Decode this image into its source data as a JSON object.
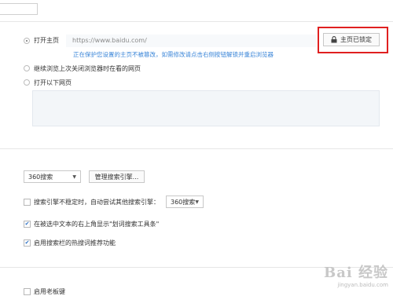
{
  "startup": {
    "options": [
      {
        "label": "打开主页",
        "selected": true
      },
      {
        "label": "继续浏览上次关闭浏览器时在看的网页",
        "selected": false
      },
      {
        "label": "打开以下网页",
        "selected": false
      }
    ],
    "homepage_url": "https://www.baidu.com/",
    "protect_hint": "正在保护您设置的主页不被篡改，如需修改请点击右侧按钮解锁并重启浏览器",
    "lock_button_label": "主页已锁定",
    "urls_textarea_value": ""
  },
  "search": {
    "engine_selected": "360搜索",
    "manage_button_label": "管理搜索引擎...",
    "fallback_label": "搜索引擎不稳定时，自动尝试其他搜索引擎：",
    "fallback_checked": false,
    "fallback_engine": "360搜索",
    "selection_toolbar_label": "在被选中文本的右上角显示\"划词搜索工具条\"",
    "selection_toolbar_checked": true,
    "hot_words_label": "启用搜索栏的热搜词推荐功能",
    "hot_words_checked": true
  },
  "bottom": {
    "boss_key_label": "启用老板键",
    "boss_key_checked": false
  },
  "watermark": {
    "logo_text": "Bai 经验",
    "url_text": "jingyan.baidu.com"
  },
  "colors": {
    "hint_blue": "#3b86d8",
    "highlight_red": "#e02020",
    "check_blue": "#2a6fc4"
  }
}
